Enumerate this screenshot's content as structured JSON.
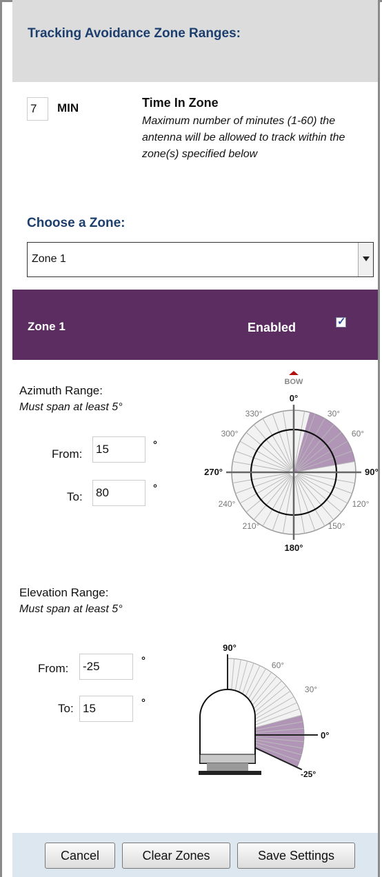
{
  "header": {
    "title": "Tracking Avoidance Zone Ranges:"
  },
  "time_in_zone": {
    "value": "7",
    "unit": "MIN",
    "title": "Time In Zone",
    "description": "Maximum number of minutes (1-60) the antenna will be allowed to track within the zone(s) specified below"
  },
  "zone_chooser": {
    "label": "Choose a Zone:",
    "selected": "Zone 1"
  },
  "zone": {
    "title": "Zone 1",
    "enabled_label": "Enabled",
    "enabled": true
  },
  "azimuth": {
    "label": "Azimuth Range:",
    "hint": "Must span at least 5°",
    "from_label": "From:",
    "from_value": "15",
    "to_label": "To:",
    "to_value": "80",
    "deg": "°",
    "diagram": {
      "bow_label": "BOW",
      "ticks": {
        "0": "0°",
        "30": "30°",
        "60": "60°",
        "90": "90°",
        "120": "120°",
        "150": "150°",
        "180": "180°",
        "210": "210°",
        "240": "240°",
        "270": "270°",
        "300": "300°",
        "330": "330°"
      },
      "zone_from": 15,
      "zone_to": 80
    }
  },
  "elevation": {
    "label": "Elevation Range:",
    "hint": "Must span at least 5°",
    "from_label": "From:",
    "from_value": "-25",
    "to_label": "To:",
    "to_value": "15",
    "deg": "°",
    "diagram": {
      "ticks": {
        "90": "90°",
        "60": "60°",
        "30": "30°",
        "0": "0°",
        "-25": "-25°"
      },
      "zone_from": -25,
      "zone_to": 15
    }
  },
  "colors": {
    "zone_fill": "#a98bb0",
    "header_bg": "#dcdcdc",
    "zone_bar": "#5c2d61",
    "title_blue": "#1d3f6e"
  },
  "buttons": {
    "cancel": "Cancel",
    "clear": "Clear Zones",
    "save": "Save Settings"
  }
}
